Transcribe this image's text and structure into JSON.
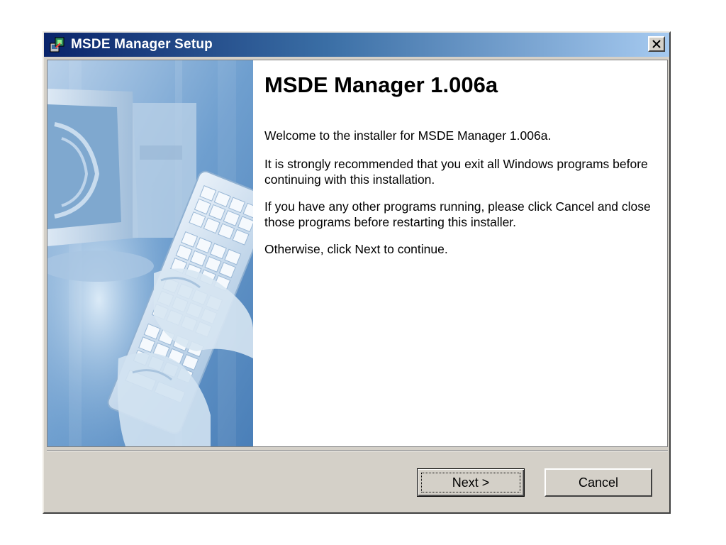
{
  "window": {
    "title": "MSDE Manager Setup",
    "title_bar_gradient": [
      "#0a246a",
      "#a6caf0"
    ],
    "close_icon": "close-x-icon"
  },
  "main": {
    "heading": "MSDE Manager 1.006a",
    "paragraphs": [
      "Welcome to the installer for MSDE Manager 1.006a.",
      "It is strongly recommended that you exit all Windows programs before continuing with this installation.",
      "If you have any other programs running, please click Cancel and close those programs before restarting this installer.",
      "Otherwise, click Next to continue."
    ]
  },
  "side_image": {
    "subject": "computer-monitor-and-keyboard-with-hands",
    "tint": "#6c9bc8"
  },
  "buttons": {
    "next_label": "Next >",
    "cancel_label": "Cancel"
  }
}
